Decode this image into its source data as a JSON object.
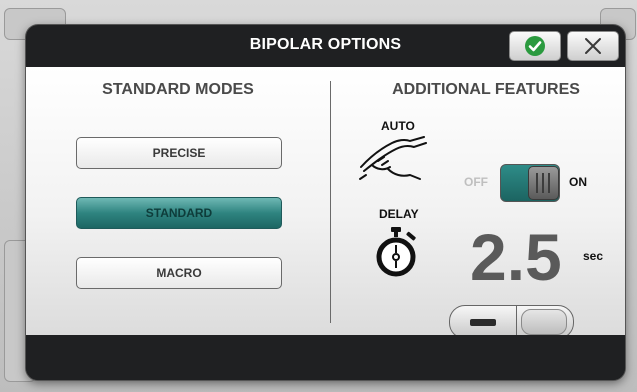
{
  "dialog": {
    "title": "BIPOLAR OPTIONS",
    "confirm_icon": "check-icon",
    "close_icon": "close-icon"
  },
  "standard_modes": {
    "heading": "STANDARD MODES",
    "modes": [
      {
        "label": "PRECISE",
        "selected": false
      },
      {
        "label": "STANDARD",
        "selected": true
      },
      {
        "label": "MACRO",
        "selected": false
      }
    ]
  },
  "additional_features": {
    "heading": "ADDITIONAL FEATURES",
    "auto": {
      "label": "AUTO",
      "icon": "handpiece-icon",
      "off_label": "OFF",
      "on_label": "ON",
      "state": "on"
    },
    "delay": {
      "label": "DELAY",
      "icon": "stopwatch-icon",
      "value": "2.5",
      "unit": "sec",
      "decrement_icon": "minus-icon",
      "increment_icon": "plus-icon"
    }
  },
  "colors": {
    "accent_teal": "#2f8480",
    "confirm_green": "#2b9a3f",
    "dialog_dark": "#1f2022"
  }
}
